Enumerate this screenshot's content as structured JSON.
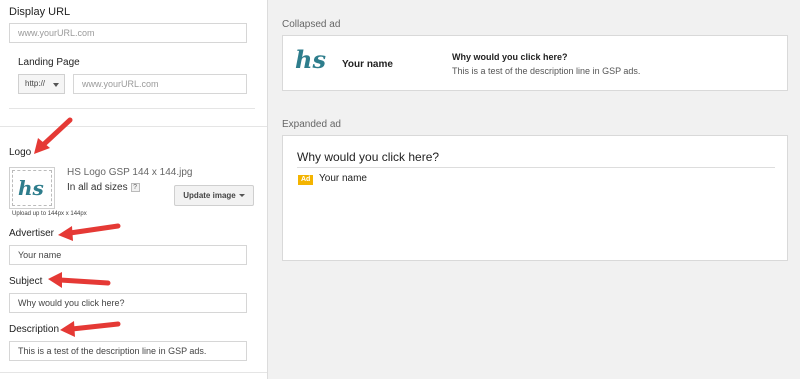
{
  "form": {
    "display_url": {
      "label": "Display URL",
      "placeholder": "www.yourURL.com"
    },
    "landing_page": {
      "label": "Landing Page",
      "protocol": "http://",
      "placeholder": "www.yourURL.com"
    },
    "logo": {
      "label": "Logo",
      "logo_text": "hs",
      "file_name": "HS Logo GSP 144 x 144.jpg",
      "sizes_text": "In all ad sizes",
      "help": "?",
      "update_button": "Update image",
      "upload_hint": "Upload up to 144px x 144px"
    },
    "advertiser": {
      "label": "Advertiser",
      "value": "Your name"
    },
    "subject": {
      "label": "Subject",
      "value": "Why would you click here?"
    },
    "description": {
      "label": "Description",
      "value": "This is a test of the description line in GSP ads."
    }
  },
  "preview": {
    "collapsed": {
      "label": "Collapsed ad",
      "logo_text": "hs",
      "name": "Your name",
      "headline": "Why would you click here?",
      "description": "This is a test of the description line in GSP ads."
    },
    "expanded": {
      "label": "Expanded ad",
      "headline": "Why would you click here?",
      "badge": "Ad",
      "name": "Your name"
    }
  },
  "colors": {
    "arrow": "#e53935",
    "ad_badge": "#f4b400",
    "logo": "#2e7d8c",
    "panel_bg": "#f1f1f1"
  }
}
